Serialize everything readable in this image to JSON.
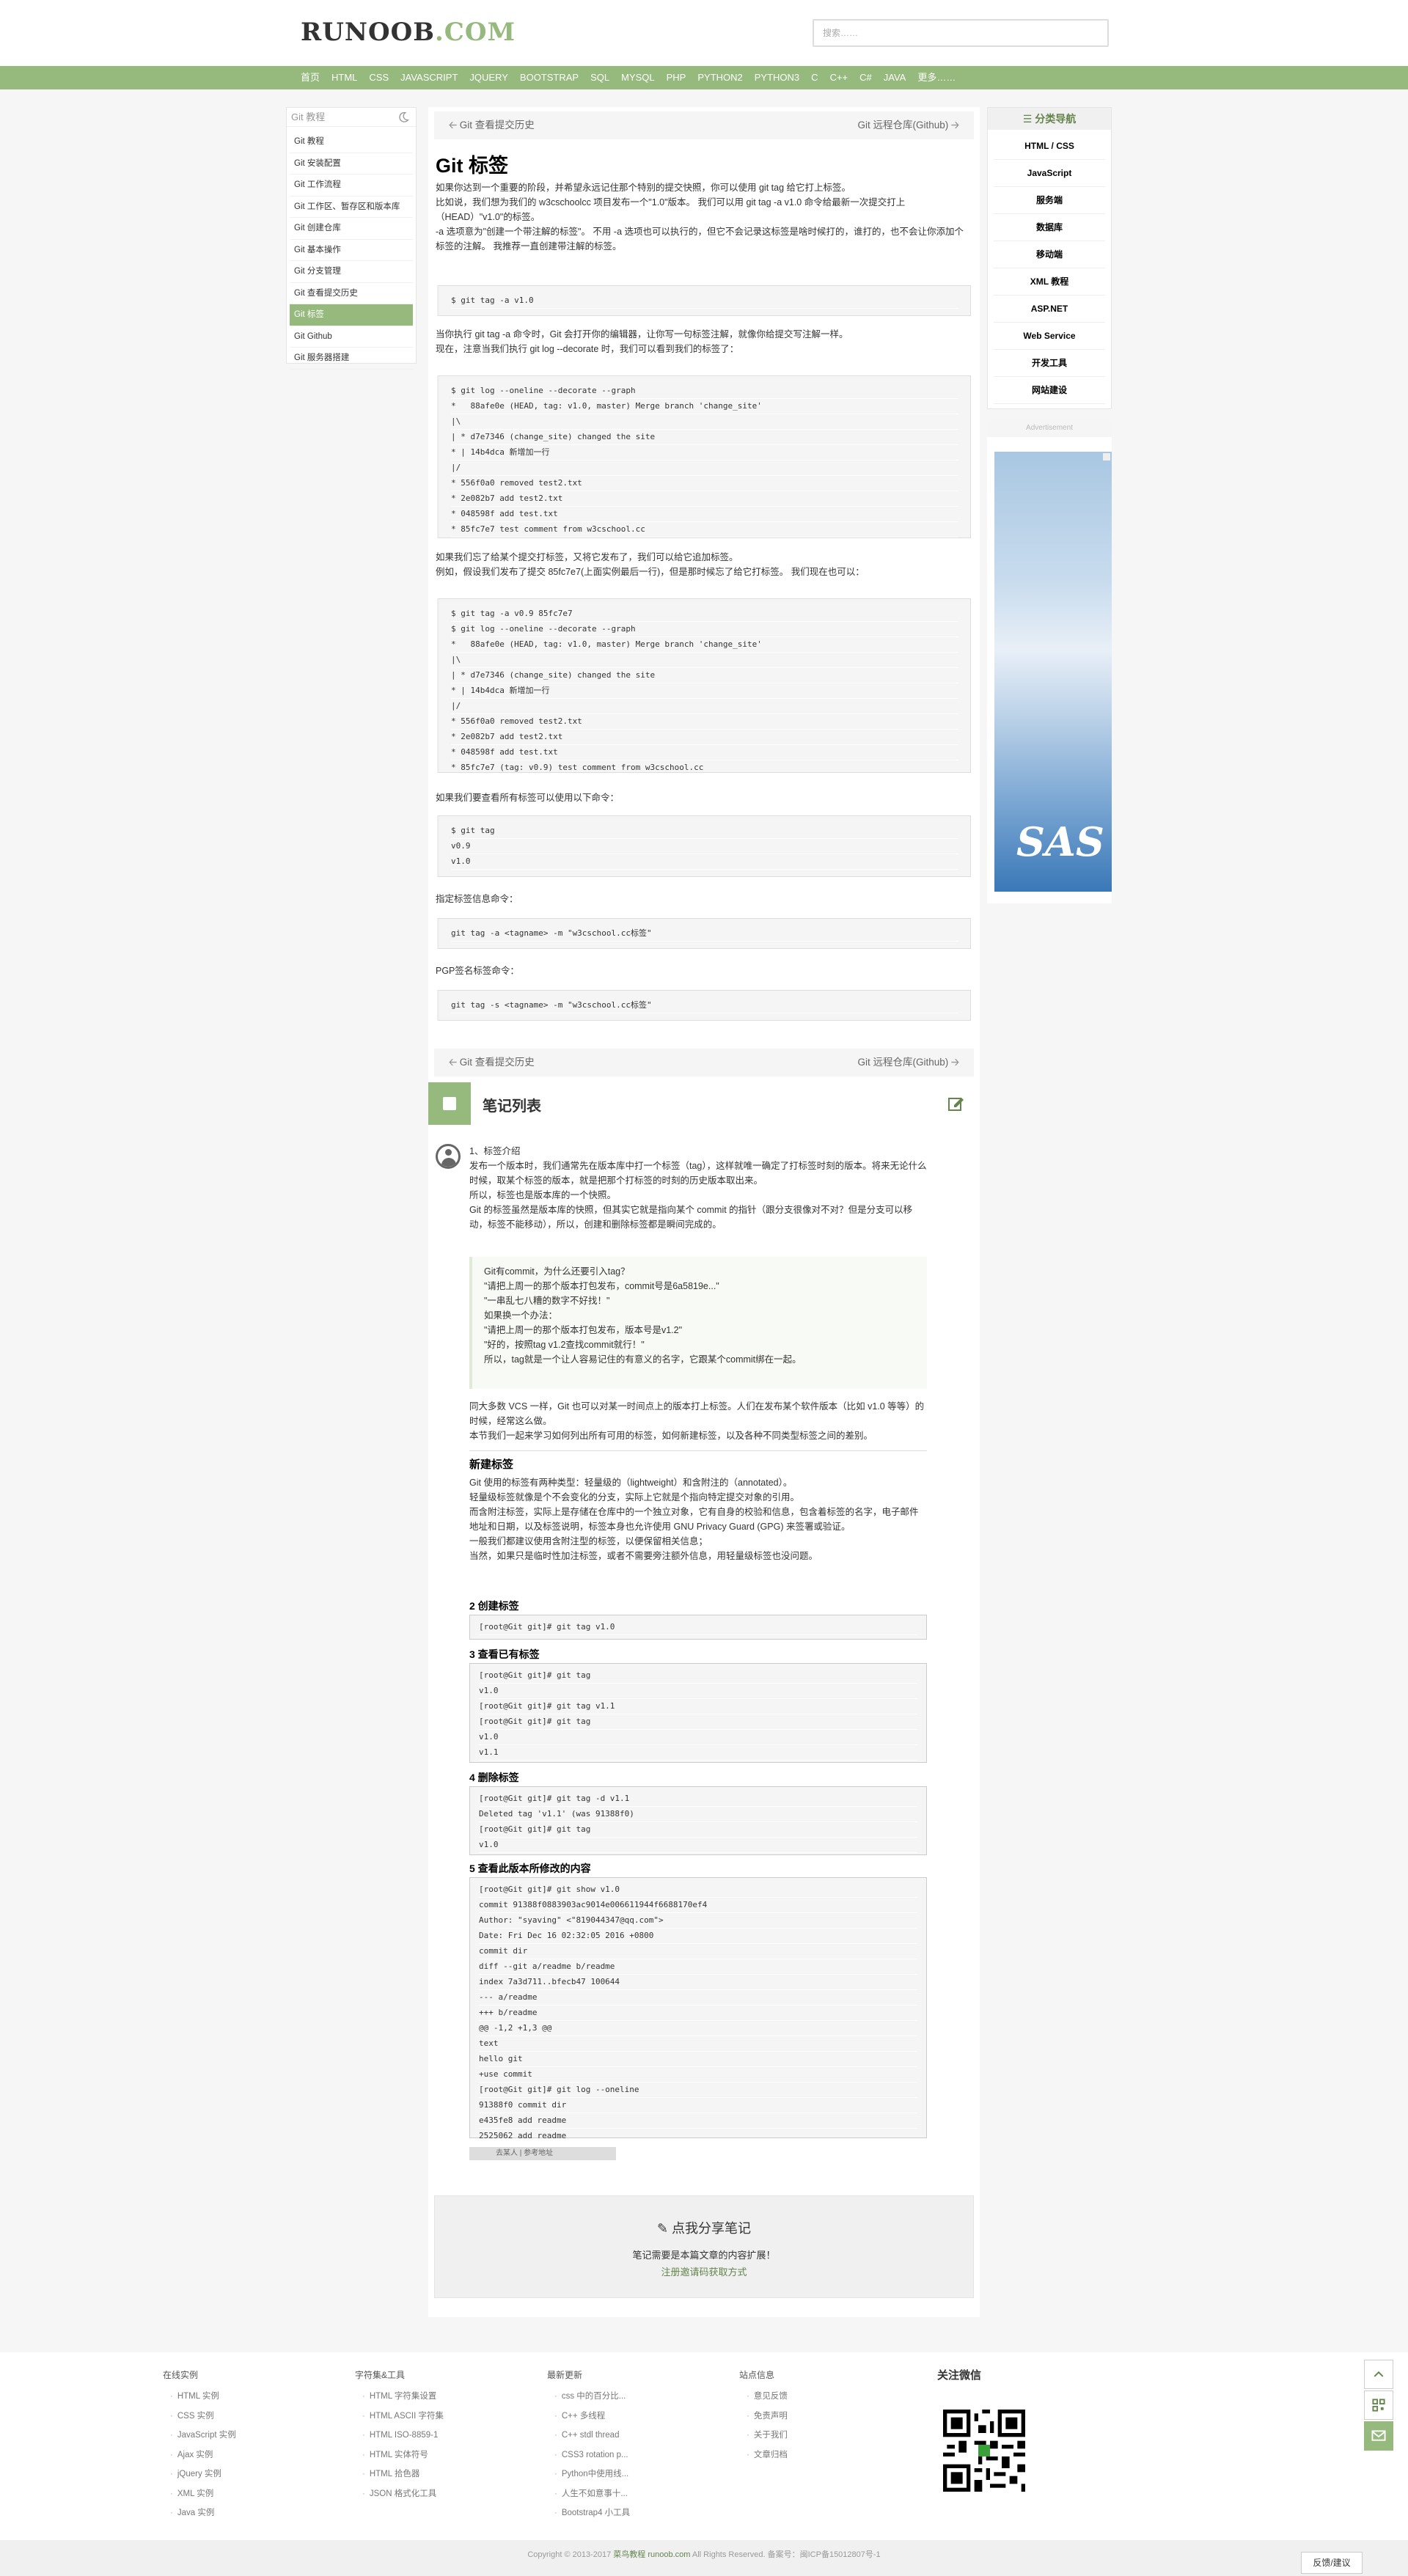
{
  "header": {
    "logo_a": "RUNOOB",
    "logo_b": ".COM",
    "search_placeholder": "搜索……"
  },
  "nav": [
    "首页",
    "HTML",
    "CSS",
    "JAVASCRIPT",
    "JQUERY",
    "BOOTSTRAP",
    "SQL",
    "MYSQL",
    "PHP",
    "PYTHON2",
    "PYTHON3",
    "C",
    "C++",
    "C#",
    "JAVA",
    "更多……"
  ],
  "left": {
    "title": "Git 教程",
    "items": [
      "Git 教程",
      "Git 安装配置",
      "Git 工作流程",
      "Git 工作区、暂存区和版本库",
      "Git 创建仓库",
      "Git 基本操作",
      "Git 分支管理",
      "Git 查看提交历史",
      "Git 标签",
      "Git Github",
      "Git 服务器搭建"
    ],
    "active": 8
  },
  "article": {
    "prev": "Git 查看提交历史",
    "next": "Git 远程仓库(Github)",
    "title": "Git 标签",
    "p1": [
      "如果你达到一个重要的阶段，并希望永远记住那个特别的提交快照，你可以使用 git tag 给它打上标签。",
      "比如说，我们想为我们的 w3cschoolcc 项目发布一个\"1.0\"版本。 我们可以用 git tag -a v1.0 命令给最新一次提交打上（HEAD）\"v1.0\"的标签。",
      "-a 选项意为\"创建一个带注解的标签\"。 不用 -a 选项也可以执行的，但它不会记录这标签是啥时候打的，谁打的，也不会让你添加个标签的注解。 我推荐一直创建带注解的标签。"
    ],
    "c1": [
      "$ git tag -a v1.0"
    ],
    "p2": [
      "当你执行 git tag -a 命令时，Git 会打开你的编辑器，让你写一句标签注解，就像你给提交写注解一样。",
      "现在，注意当我们执行 git log --decorate 时，我们可以看到我们的标签了："
    ],
    "c2": [
      "$ git log --oneline --decorate --graph",
      "*   88afe0e (HEAD, tag: v1.0, master) Merge branch 'change_site'",
      "|\\",
      "| * d7e7346 (change_site) changed the site",
      "* | 14b4dca 新增加一行",
      "|/",
      "* 556f0a0 removed test2.txt",
      "* 2e082b7 add test2.txt",
      "* 048598f add test.txt",
      "* 85fc7e7 test comment from w3cschool.cc"
    ],
    "p3": [
      "如果我们忘了给某个提交打标签，又将它发布了，我们可以给它追加标签。",
      "例如，假设我们发布了提交 85fc7e7(上面实例最后一行)，但是那时候忘了给它打标签。 我们现在也可以："
    ],
    "c3": [
      "$ git tag -a v0.9 85fc7e7",
      "$ git log --oneline --decorate --graph",
      "*   88afe0e (HEAD, tag: v1.0, master) Merge branch 'change_site'",
      "|\\",
      "| * d7e7346 (change_site) changed the site",
      "* | 14b4dca 新增加一行",
      "|/",
      "* 556f0a0 removed test2.txt",
      "* 2e082b7 add test2.txt",
      "* 048598f add test.txt",
      "* 85fc7e7 (tag: v0.9) test comment from w3cschool.cc"
    ],
    "p4": "如果我们要查看所有标签可以使用以下命令：",
    "c4": [
      "$ git tag",
      "v0.9",
      "v1.0"
    ],
    "p5": "指定标签信息命令：",
    "c5": [
      "git tag -a <tagname> -m \"w3cschool.cc标签\""
    ],
    "p6": "PGP签名标签命令：",
    "c6": [
      "git tag -s <tagname> -m \"w3cschool.cc标签\""
    ]
  },
  "notes": {
    "heading": "笔记列表",
    "n1": [
      "1、标签介绍",
      "发布一个版本时，我们通常先在版本库中打一个标签（tag），这样就唯一确定了打标签时刻的版本。将来无论什么时候，取某个标签的版本，就是把那个打标签的时刻的历史版本取出来。",
      "所以，标签也是版本库的一个快照。",
      "Git 的标签虽然是版本库的快照，但其实它就是指向某个 commit 的指针（跟分支很像对不对？但是分支可以移动，标签不能移动），所以，创建和删除标签都是瞬间完成的。"
    ],
    "quote": [
      "Git有commit，为什么还要引入tag？",
      "\"请把上周一的那个版本打包发布，commit号是6a5819e...\"",
      "\"一串乱七八糟的数字不好找！\"",
      "如果换一个办法：",
      "\"请把上周一的那个版本打包发布，版本号是v1.2\"",
      "\"好的，按照tag v1.2查找commit就行！\"",
      "所以，tag就是一个让人容易记住的有意义的名字，它跟某个commit绑在一起。"
    ],
    "n2": [
      "同大多数 VCS 一样，Git 也可以对某一时间点上的版本打上标签。人们在发布某个软件版本（比如 v1.0 等等）的时候，经常这么做。",
      "本节我们一起来学习如何列出所有可用的标签，如何新建标签，以及各种不同类型标签之间的差别。"
    ],
    "h_new": "新建标签",
    "n3": [
      "Git 使用的标签有两种类型：轻量级的（lightweight）和含附注的（annotated）。",
      "轻量级标签就像是个不会变化的分支，实际上它就是个指向特定提交对象的引用。",
      "而含附注标签，实际上是存储在仓库中的一个独立对象，它有自身的校验和信息，包含着标签的名字，电子邮件地址和日期，以及标签说明，标签本身也允许使用 GNU Privacy Guard (GPG) 来签署或验证。",
      "一般我们都建议使用含附注型的标签，以便保留相关信息；",
      "当然，如果只是临时性加注标签，或者不需要旁注额外信息，用轻量级标签也没问题。"
    ],
    "h2": "2 创建标签",
    "k2": [
      "[root@Git git]# git tag v1.0"
    ],
    "h3": "3 查看已有标签",
    "k3": [
      "[root@Git git]# git tag",
      "v1.0",
      "[root@Git git]# git tag v1.1",
      "[root@Git git]# git tag",
      "v1.0",
      "v1.1"
    ],
    "h4": "4 删除标签",
    "k4": [
      "[root@Git git]# git tag -d v1.1",
      "Deleted tag 'v1.1' (was 91388f0)",
      "[root@Git git]# git tag",
      "v1.0"
    ],
    "h5": "5 查看此版本所修改的内容",
    "k5": [
      "[root@Git git]# git show v1.0",
      "commit 91388f0883903ac9014e006611944f6688170ef4",
      "Author: \"syaving\" <\"819044347@qq.com\">",
      "Date: Fri Dec 16 02:32:05 2016 +0800",
      "commit dir",
      "diff --git a/readme b/readme",
      "index 7a3d711..bfecb47 100644",
      "--- a/readme",
      "+++ b/readme",
      "@@ -1,2 +1,3 @@",
      "text",
      "hello git",
      "+use commit",
      "[root@Git git]# git log --oneline",
      "91388f0 commit dir",
      "e435fe8 add readme",
      "2525062 add readme"
    ],
    "vote": "去某人 | 参考地址",
    "share_title": "点我分享笔记",
    "share_l1": "笔记需要是本篇文章的内容扩展！",
    "share_l2": "注册邀请码获取方式"
  },
  "right": {
    "title": "分类导航",
    "items": [
      "HTML / CSS",
      "JavaScript",
      "服务端",
      "数据库",
      "移动端",
      "XML 教程",
      "ASP.NET",
      "Web Service",
      "开发工具",
      "网站建设"
    ],
    "ad_label": "Advertisement",
    "ad_brand": "SAS"
  },
  "footer": {
    "cols": [
      {
        "title": "在线实例",
        "items": [
          "HTML 实例",
          "CSS 实例",
          "JavaScript 实例",
          "Ajax 实例",
          "jQuery 实例",
          "XML 实例",
          "Java 实例"
        ]
      },
      {
        "title": "字符集&工具",
        "items": [
          "HTML 字符集设置",
          "HTML ASCII 字符集",
          "HTML ISO-8859-1",
          "HTML 实体符号",
          "HTML 拾色器",
          "JSON 格式化工具"
        ]
      },
      {
        "title": "最新更新",
        "items": [
          "css 中的百分比...",
          "C++ 多线程",
          "C++ stdl thread",
          "CSS3 rotation p...",
          "Python中使用线...",
          "人生不如意事十...",
          "Bootstrap4 小工具"
        ]
      },
      {
        "title": "站点信息",
        "items": [
          "意见反馈",
          "免责声明",
          "关于我们",
          "文章归档"
        ]
      }
    ],
    "wechat": "关注微信",
    "copyright_a": "Copyright © 2013-2017",
    "copyright_b": "菜鸟教程",
    "copyright_c": "runoob.com",
    "copyright_d": "All Rights Reserved. 备案号：闽ICP备15012807号-1",
    "feedback": "反馈/建议"
  }
}
